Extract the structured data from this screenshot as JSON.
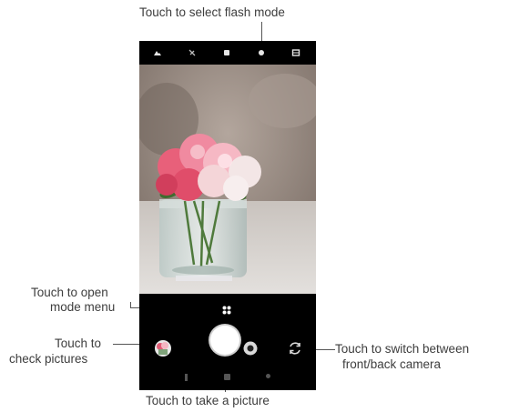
{
  "annotations": {
    "flash_mode": "Touch to select flash mode",
    "open_mode_menu_1": "Touch to open",
    "open_mode_menu_2": "mode menu",
    "check_pictures_1": "Touch to",
    "check_pictures_2": "check  pictures",
    "switch_camera_1": "Touch to switch between",
    "switch_camera_2": "front/back camera",
    "take_picture": "Touch to take a picture"
  },
  "top_bar": {
    "icons": [
      "hdr-icon",
      "flash-off-icon",
      "timer-icon",
      "flash-mode-icon",
      "grid-icon"
    ]
  },
  "viewfinder": {
    "subject": "pink and white flowers in a glass jar"
  },
  "bottom_bar": {
    "icons": [
      "mode-menu-icon",
      "gallery-thumbnail",
      "shutter-button",
      "video-icon",
      "switch-camera-icon"
    ],
    "nav": [
      "nav-back",
      "nav-home",
      "nav-recent"
    ]
  },
  "colors": {
    "phone_bg": "#000000",
    "shutter": "#ffffff",
    "callout_line": "#555555"
  }
}
